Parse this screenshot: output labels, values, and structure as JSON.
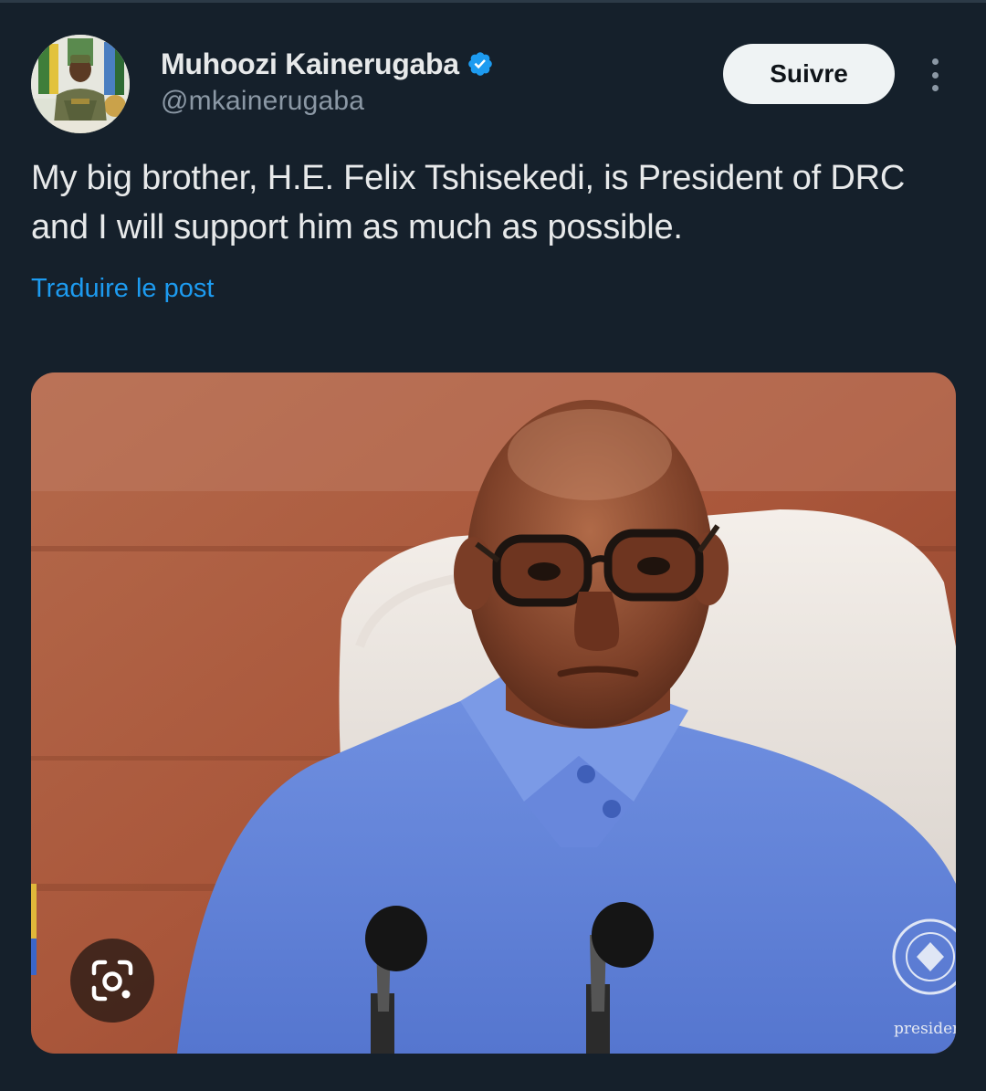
{
  "post": {
    "author": {
      "display_name": "Muhoozi Kainerugaba",
      "handle": "@mkainerugaba",
      "verified": true,
      "verified_color": "#1d9bf0"
    },
    "follow_label": "Suivre",
    "more_icon": "more-vertical-icon",
    "text": "My big brother, H.E. Felix Tshisekedi, is President of DRC and I will support him as much as possible.",
    "translate_label": "Traduire le post",
    "media": {
      "lens_icon": "google-lens-icon",
      "watermark_text": "presiden"
    }
  },
  "colors": {
    "background": "#15202b",
    "text_primary": "#e7e9ea",
    "text_secondary": "#8b98a5",
    "link": "#1d9bf0",
    "button_bg": "#eff3f4"
  }
}
